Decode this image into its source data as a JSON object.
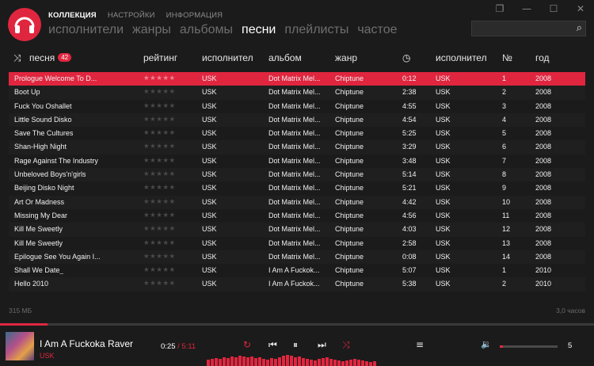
{
  "window": {
    "min": "—",
    "max": "☐",
    "close": "✕",
    "restore": "❐"
  },
  "topnav": [
    "КОЛЛЕКЦИЯ",
    "НАСТРОЙКИ",
    "ИНФОРМАЦИЯ"
  ],
  "subnav": [
    "исполнители",
    "жанры",
    "альбомы",
    "песни",
    "плейлисты",
    "частое"
  ],
  "search": {
    "placeholder": ""
  },
  "columns": {
    "song": "песня",
    "song_count": "42",
    "rating": "рейтинг",
    "artist": "исполнител",
    "album": "альбом",
    "genre": "жанр",
    "album_artist": "исполнител",
    "track_no": "№",
    "year": "год"
  },
  "rows": [
    {
      "song": "Prologue Welcome To D...",
      "artist": "USK",
      "album": "Dot Matrix Mel...",
      "genre": "Chiptune",
      "time": "0:12",
      "album_artist": "USK",
      "no": "1",
      "year": "2008"
    },
    {
      "song": "Boot Up",
      "artist": "USK",
      "album": "Dot Matrix Mel...",
      "genre": "Chiptune",
      "time": "2:38",
      "album_artist": "USK",
      "no": "2",
      "year": "2008"
    },
    {
      "song": "Fuck You Oshallet",
      "artist": "USK",
      "album": "Dot Matrix Mel...",
      "genre": "Chiptune",
      "time": "4:55",
      "album_artist": "USK",
      "no": "3",
      "year": "2008"
    },
    {
      "song": "Little Sound Disko",
      "artist": "USK",
      "album": "Dot Matrix Mel...",
      "genre": "Chiptune",
      "time": "4:54",
      "album_artist": "USK",
      "no": "4",
      "year": "2008"
    },
    {
      "song": "Save The Cultures",
      "artist": "USK",
      "album": "Dot Matrix Mel...",
      "genre": "Chiptune",
      "time": "5:25",
      "album_artist": "USK",
      "no": "5",
      "year": "2008"
    },
    {
      "song": "Shan-High Night",
      "artist": "USK",
      "album": "Dot Matrix Mel...",
      "genre": "Chiptune",
      "time": "3:29",
      "album_artist": "USK",
      "no": "6",
      "year": "2008"
    },
    {
      "song": "Rage Against The Industry",
      "artist": "USK",
      "album": "Dot Matrix Mel...",
      "genre": "Chiptune",
      "time": "3:48",
      "album_artist": "USK",
      "no": "7",
      "year": "2008"
    },
    {
      "song": "Unbeloved Boys'n'girls",
      "artist": "USK",
      "album": "Dot Matrix Mel...",
      "genre": "Chiptune",
      "time": "5:14",
      "album_artist": "USK",
      "no": "8",
      "year": "2008"
    },
    {
      "song": "Beijing Disko Night",
      "artist": "USK",
      "album": "Dot Matrix Mel...",
      "genre": "Chiptune",
      "time": "5:21",
      "album_artist": "USK",
      "no": "9",
      "year": "2008"
    },
    {
      "song": "Art Or Madness",
      "artist": "USK",
      "album": "Dot Matrix Mel...",
      "genre": "Chiptune",
      "time": "4:42",
      "album_artist": "USK",
      "no": "10",
      "year": "2008"
    },
    {
      "song": "Missing My Dear",
      "artist": "USK",
      "album": "Dot Matrix Mel...",
      "genre": "Chiptune",
      "time": "4:56",
      "album_artist": "USK",
      "no": "11",
      "year": "2008"
    },
    {
      "song": "Kill Me Sweetly",
      "artist": "USK",
      "album": "Dot Matrix Mel...",
      "genre": "Chiptune",
      "time": "4:03",
      "album_artist": "USK",
      "no": "12",
      "year": "2008"
    },
    {
      "song": "Kill Me Sweetly",
      "artist": "USK",
      "album": "Dot Matrix Mel...",
      "genre": "Chiptune",
      "time": "2:58",
      "album_artist": "USK",
      "no": "13",
      "year": "2008"
    },
    {
      "song": "Epilogue See You Again I...",
      "artist": "USK",
      "album": "Dot Matrix Mel...",
      "genre": "Chiptune",
      "time": "0:08",
      "album_artist": "USK",
      "no": "14",
      "year": "2008"
    },
    {
      "song": "Shall We Date_",
      "artist": "USK",
      "album": "I Am A Fuckok...",
      "genre": "Chiptune",
      "time": "5:07",
      "album_artist": "USK",
      "no": "1",
      "year": "2010"
    },
    {
      "song": "Hello 2010",
      "artist": "USK",
      "album": "I Am A Fuckok...",
      "genre": "Chiptune",
      "time": "5:38",
      "album_artist": "USK",
      "no": "2",
      "year": "2010"
    }
  ],
  "footer": {
    "size": "315 МБ",
    "duration": "3,0 часов"
  },
  "player": {
    "title": "I Am A Fuckoka Raver",
    "artist": "USK",
    "current_time": "0:25",
    "separator": " / ",
    "total_time": "5:11",
    "volume": "5",
    "progress_fraction": 0.08,
    "volume_fraction": 0.05
  },
  "colors": {
    "accent": "#e0263f",
    "bg": "#1b1b1b"
  },
  "icons": {
    "shuffle": "⤨",
    "clock": "◷",
    "search": "⌕",
    "repeat": "↻",
    "prev": "⏮",
    "pause": "⏸",
    "next": "⏭",
    "eq": "≡",
    "volume": "🔉"
  }
}
